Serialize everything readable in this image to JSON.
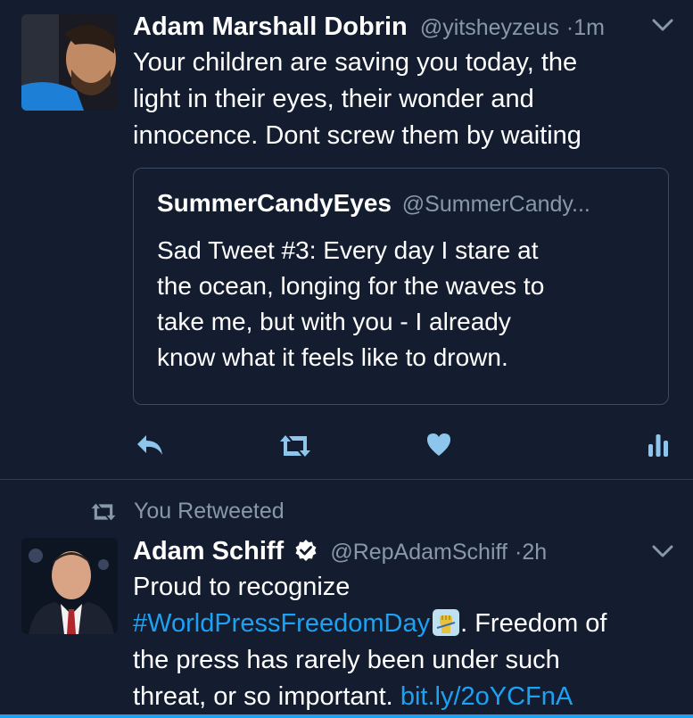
{
  "tweet1": {
    "name": "Adam Marshall Dobrin",
    "handle": "@yitsheyzeus",
    "separator": "·",
    "time": "1m",
    "lines": [
      "Your children are saving you today, the",
      "light in their eyes, their wonder and",
      "innocence.  Dont screw them by waiting"
    ],
    "quote": {
      "name": "SummerCandyEyes",
      "handle": "@SummerCandy...",
      "lines": [
        "Sad Tweet #3:  Every day I stare at",
        "the ocean, longing for the waves to",
        "take me, but with you - I already",
        "know what it feels like to drown."
      ]
    },
    "actions": [
      "reply-icon",
      "retweet-icon",
      "heart-icon",
      "analytics-icon"
    ]
  },
  "retweet_label": "You Retweeted",
  "tweet2": {
    "name": "Adam Schiff",
    "handle": "@RepAdamSchiff",
    "separator": "·",
    "time": "2h",
    "line1": "Proud to recognize",
    "hashtag": "#WorldPressFreedomDay",
    "line2_rest": ". Freedom of",
    "line3": "the press has rarely been under such",
    "line4_text": "threat, or so important.",
    "link": "bit.ly/2oYCFnA"
  },
  "colors": {
    "background": "#141d30",
    "accent": "#1da1f2",
    "muted": "#8899a6",
    "action_icon": "#8ec5ec"
  }
}
